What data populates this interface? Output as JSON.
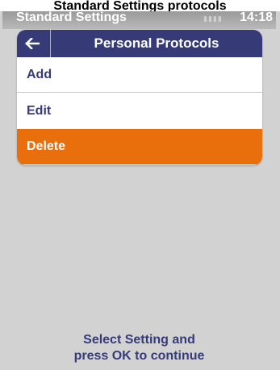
{
  "caption": "Standard Settings protocols",
  "status_bar": {
    "title": "Standard Settings",
    "battery": "▮▮▮▮",
    "time": "14:18"
  },
  "header": {
    "back_icon": "arrow-left-icon",
    "title": "Personal Protocols"
  },
  "menu": {
    "items": [
      {
        "label": "Add"
      },
      {
        "label": "Edit"
      },
      {
        "label": "Delete"
      }
    ],
    "selected_index": 2
  },
  "footer": {
    "line1": "Select Setting and",
    "line2": "press OK to continue"
  },
  "colors": {
    "header_bg": "#363b78",
    "accent_selected": "#e86f0c",
    "screen_bg": "#d2d2d2",
    "text_primary": "#363b78"
  }
}
